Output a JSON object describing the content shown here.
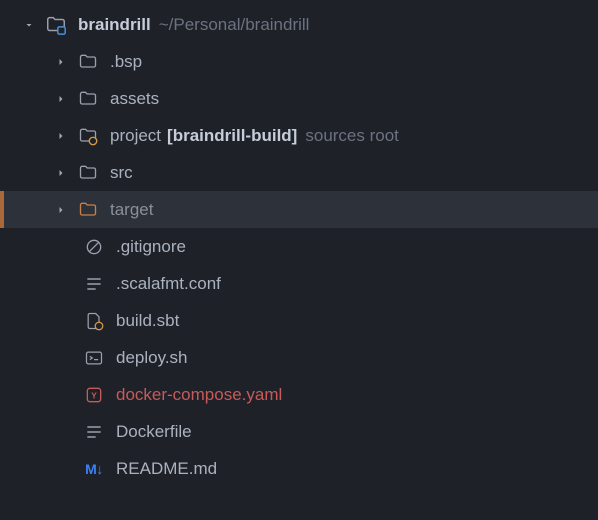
{
  "root": {
    "name": "braindrill",
    "path": "~/Personal/braindrill"
  },
  "items": [
    {
      "name": ".bsp",
      "kind": "folder",
      "expandable": true
    },
    {
      "name": "assets",
      "kind": "folder",
      "expandable": true
    },
    {
      "name": "project",
      "kind": "folder-special",
      "expandable": true,
      "suffix": "[braindrill-build]",
      "annotation": "sources root"
    },
    {
      "name": "src",
      "kind": "folder",
      "expandable": true
    },
    {
      "name": "target",
      "kind": "folder-target",
      "expandable": true,
      "selected": true
    },
    {
      "name": ".gitignore",
      "kind": "ignore"
    },
    {
      "name": ".scalafmt.conf",
      "kind": "text"
    },
    {
      "name": "build.sbt",
      "kind": "sbt"
    },
    {
      "name": "deploy.sh",
      "kind": "shell"
    },
    {
      "name": "docker-compose.yaml",
      "kind": "docker-compose"
    },
    {
      "name": "Dockerfile",
      "kind": "text"
    },
    {
      "name": "README.md",
      "kind": "markdown"
    }
  ]
}
